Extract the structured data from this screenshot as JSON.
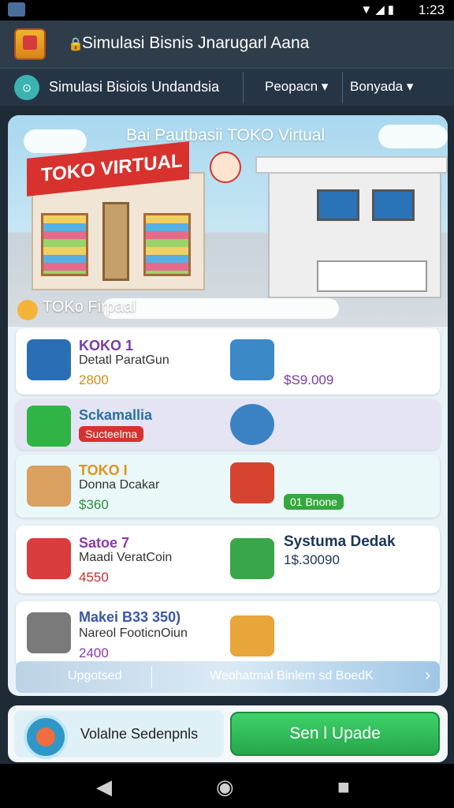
{
  "status_bar": {
    "time": "1:23",
    "icons": "▼◢▮"
  },
  "app_bar": {
    "title": "Simulasi Bisnis Jnarugarl Aana"
  },
  "sub_bar": {
    "title": "Simulasi Bisiois Undandsia",
    "dropdown1": "Peopacn ▾",
    "dropdown2": "Bonyada ▾"
  },
  "hero": {
    "title": "Bai Pautbasii TOKO Virtual",
    "store_sign": "TOKO VIRTUAL",
    "section_label": "TOKo Firpaal"
  },
  "rows": [
    {
      "name": "KOKO 1",
      "desc": "Detatl ParatGun",
      "price": "2800",
      "right_price": "$S9.009"
    },
    {
      "name": "Sckamallia",
      "tag": "Sucteelma"
    },
    {
      "name": "TOKO I",
      "desc": "Donna Dcakar",
      "price": "$360",
      "right_tag": "01 Bnone"
    },
    {
      "name": "Satoe 7",
      "desc": "Maadi VeratCoin",
      "price": "4550",
      "right_name": "Systuma Dedak",
      "right_price": "1$.30090"
    },
    {
      "name": "Makei B33 350)",
      "desc": "Nareol FooticnOiun",
      "price": "2400"
    }
  ],
  "bottom_bar": {
    "tab1": "Upgotsed",
    "tab2": "Weohatmal Binlem sd BoedK",
    "chevron": "›"
  },
  "footer": {
    "left_label": "Volalne Sedenpnls",
    "upgrade_label": "Sen l Upade"
  },
  "nav_bar": {
    "back": "◀",
    "home": "◉",
    "recent": "■"
  }
}
